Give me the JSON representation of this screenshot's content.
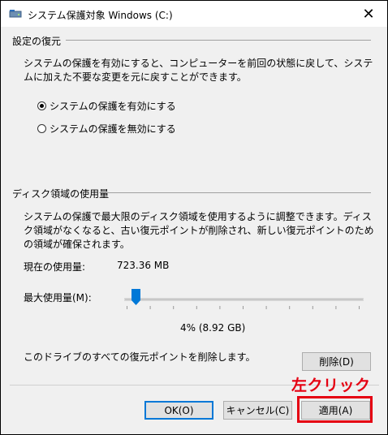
{
  "window": {
    "title": "システム保護対象 Windows (C:)",
    "close_glyph": "✕"
  },
  "restore_settings": {
    "heading": "設定の復元",
    "description": "システムの保護を有効にすると、コンピューターを前回の状態に戻して、システムに加えた不要な変更を元に戻すことができます。",
    "options": [
      {
        "label": "システムの保護を有効にする",
        "checked": true
      },
      {
        "label": "システムの保護を無効にする",
        "checked": false
      }
    ]
  },
  "disk_usage": {
    "heading": "ディスク領域の使用量",
    "description": "システムの保護で最大限のディスク領域を使用するように調整できます。ディスク領域がなくなると、古い復元ポイントが削除され、新しい復元ポイントのための領域が確保されます。",
    "current_usage_label": "現在の使用量:",
    "current_usage_value": "723.36 MB",
    "max_usage_label": "最大使用量(M):",
    "max_usage_fraction": 0.04,
    "max_usage_value": "4% (8.92 GB)",
    "delete_description": "このドライブのすべての復元ポイントを削除します。",
    "delete_button": "削除(D)"
  },
  "footer": {
    "ok_button": "OK(O)",
    "cancel_button": "キャンセル(C)",
    "apply_button": "適用(A)"
  },
  "annotation": {
    "text": "左クリック",
    "color": "#e50012"
  },
  "colors": {
    "accent": "#0078d7",
    "slider_thumb": "#0078d7",
    "annotation_red": "#e50012"
  },
  "icons": {
    "title": "drive-icon",
    "close": "close-icon"
  }
}
